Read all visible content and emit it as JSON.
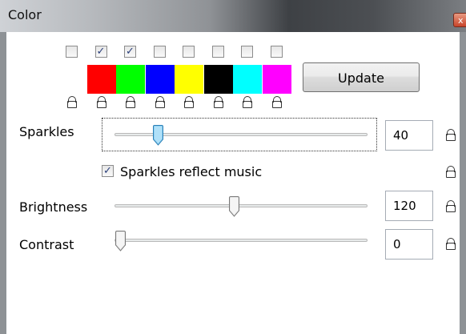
{
  "window": {
    "title": "Color",
    "close_glyph": "x"
  },
  "palette": {
    "swatches": [
      {
        "color": "#ffffff",
        "checked": false
      },
      {
        "color": "#ff0000",
        "checked": true
      },
      {
        "color": "#00ff00",
        "checked": true
      },
      {
        "color": "#0000ff",
        "checked": false
      },
      {
        "color": "#ffff00",
        "checked": false
      },
      {
        "color": "#000000",
        "checked": false
      },
      {
        "color": "#00ffff",
        "checked": false
      },
      {
        "color": "#ff00ff",
        "checked": false
      }
    ],
    "update_label": "Update"
  },
  "sparkles": {
    "label": "Sparkles",
    "value": "40",
    "level": 40,
    "max": 255
  },
  "sparkles_reflect": {
    "label": "Sparkles reflect music",
    "checked": true
  },
  "brightness": {
    "label": "Brightness",
    "value": "120",
    "level": 120,
    "max": 255
  },
  "contrast": {
    "label": "Contrast",
    "value": "0",
    "level": 0,
    "max": 255
  },
  "icons": {
    "check": "✓"
  }
}
